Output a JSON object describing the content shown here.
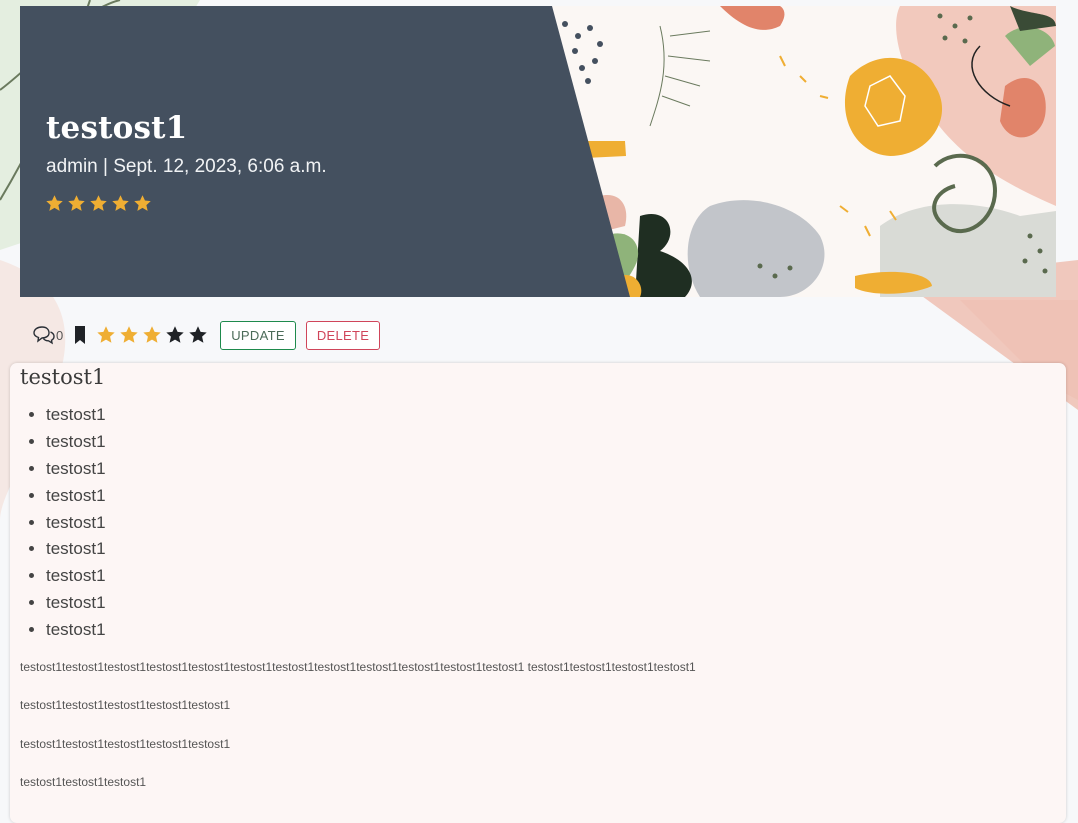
{
  "post": {
    "title": "testost1",
    "meta": "admin | Sept. 12, 2023, 6:06 a.m.",
    "rating_stars": 5
  },
  "actions": {
    "comment_count": "0",
    "rating": {
      "filled": 3,
      "total": 5
    },
    "update_label": "UPDATE",
    "delete_label": "DELETE"
  },
  "content": {
    "heading": "testost1",
    "list": [
      "testost1",
      "testost1",
      "testost1",
      "testost1",
      "testost1",
      "testost1",
      "testost1",
      "testost1",
      "testost1"
    ],
    "paragraphs": [
      "testost1testost1testost1testost1testost1testost1testost1testost1testost1testost1testost1testost1 testost1testost1testost1testost1",
      "testost1testost1testost1testost1testost1",
      "testost1testost1testost1testost1testost1",
      "testost1testost1testost1"
    ]
  },
  "icons": {
    "comments": "comments-icon",
    "bookmark": "bookmark-icon",
    "star": "star-icon"
  },
  "colors": {
    "hero_panel": "#44505f",
    "star_filled": "#efae33",
    "star_empty": "#1f2226",
    "update": "#1e8a4c",
    "delete": "#d0455a"
  }
}
